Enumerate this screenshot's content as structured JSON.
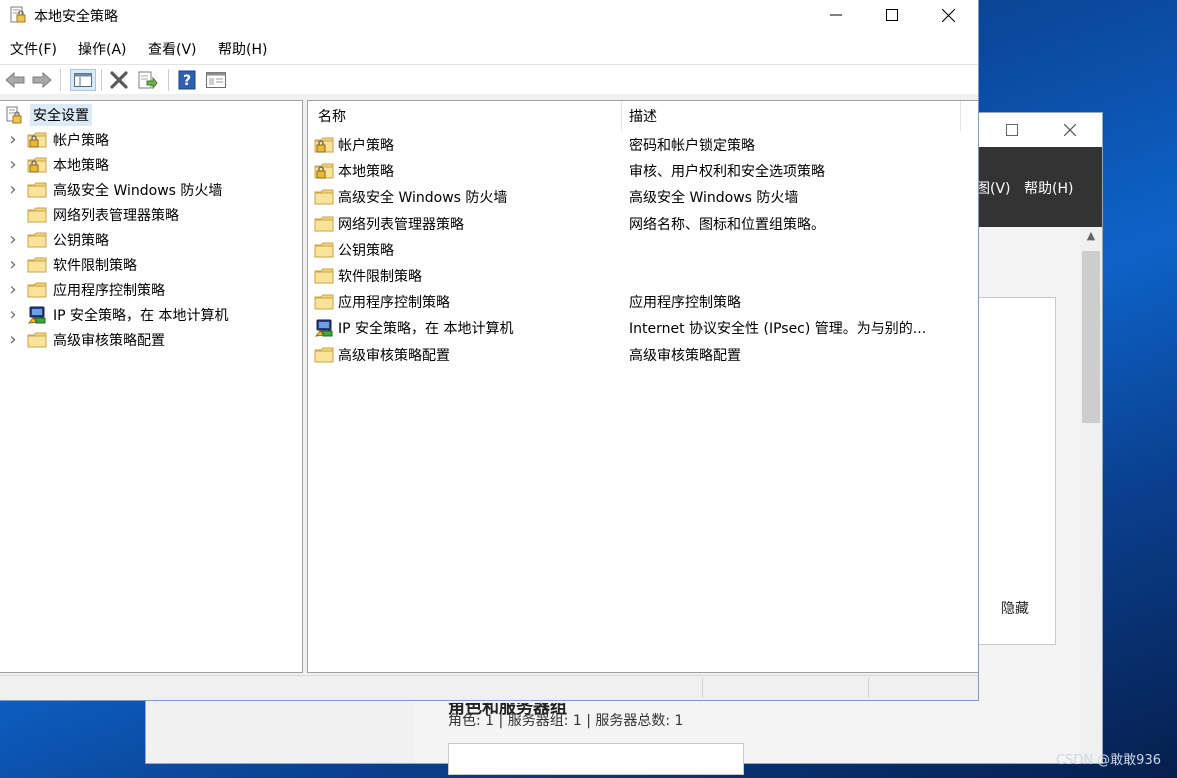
{
  "background_window": {
    "menu_view_partial": "图(V)",
    "menu_help": "帮助(H)",
    "hide_label": "隐藏",
    "section_title_partial": "角色和服务器组",
    "stats": "角色: 1 | 服务器组: 1 | 服务器总数: 1"
  },
  "watermark": "CSDN @敢敢936",
  "window": {
    "title": "本地安全策略"
  },
  "menu": {
    "file": "文件(F)",
    "action": "操作(A)",
    "view": "查看(V)",
    "help": "帮助(H)"
  },
  "toolbar": {
    "icons": [
      "back-arrow-icon",
      "forward-arrow-icon",
      "show-hide-tree-icon",
      "delete-icon",
      "export-list-icon",
      "help-icon",
      "properties-icon"
    ]
  },
  "tree": {
    "root": "安全设置",
    "items": [
      {
        "label": "帐户策略",
        "icon": "lock-folder",
        "expandable": true
      },
      {
        "label": "本地策略",
        "icon": "lock-folder",
        "expandable": true
      },
      {
        "label": "高级安全 Windows 防火墙",
        "icon": "folder",
        "expandable": true
      },
      {
        "label": "网络列表管理器策略",
        "icon": "folder",
        "expandable": false
      },
      {
        "label": "公钥策略",
        "icon": "folder",
        "expandable": true
      },
      {
        "label": "软件限制策略",
        "icon": "folder",
        "expandable": true
      },
      {
        "label": "应用程序控制策略",
        "icon": "folder",
        "expandable": true
      },
      {
        "label": "IP 安全策略，在 本地计算机",
        "icon": "ipsec",
        "expandable": true
      },
      {
        "label": "高级审核策略配置",
        "icon": "folder",
        "expandable": true
      }
    ]
  },
  "list": {
    "columns": {
      "name": "名称",
      "description": "描述"
    },
    "rows": [
      {
        "name": "帐户策略",
        "description": "密码和帐户锁定策略",
        "icon": "lock-folder"
      },
      {
        "name": "本地策略",
        "description": "审核、用户权利和安全选项策略",
        "icon": "lock-folder"
      },
      {
        "name": "高级安全 Windows 防火墙",
        "description": "高级安全 Windows 防火墙",
        "icon": "folder"
      },
      {
        "name": "网络列表管理器策略",
        "description": "网络名称、图标和位置组策略。",
        "icon": "folder"
      },
      {
        "name": "公钥策略",
        "description": "",
        "icon": "folder"
      },
      {
        "name": "软件限制策略",
        "description": "",
        "icon": "folder"
      },
      {
        "name": "应用程序控制策略",
        "description": "应用程序控制策略",
        "icon": "folder"
      },
      {
        "name": "IP 安全策略，在 本地计算机",
        "description": "Internet 协议安全性 (IPsec) 管理。为与别的...",
        "icon": "ipsec"
      },
      {
        "name": "高级审核策略配置",
        "description": "高级审核策略配置",
        "icon": "folder"
      }
    ]
  },
  "colors": {
    "folder_yellow": "#f4d37a",
    "folder_edge": "#c9a64a",
    "selection": "#dce9f7",
    "border": "#a0a0a0"
  }
}
